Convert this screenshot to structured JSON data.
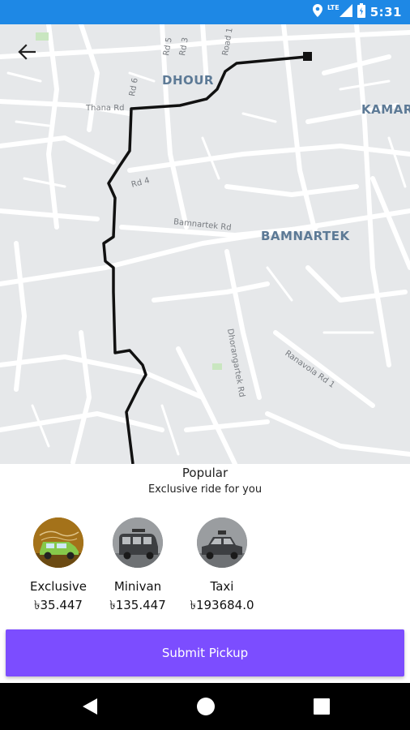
{
  "status_bar": {
    "time": "5:31",
    "network": "LTE",
    "icons": [
      "location-icon",
      "signal-icon",
      "battery-icon"
    ],
    "color": "#1e88e5"
  },
  "map": {
    "area_labels": [
      "DHOUR",
      "KAMAR",
      "BAMNARTEK"
    ],
    "road_labels": [
      "Rd 5",
      "Rd 3",
      "Road 1",
      "Rd 6",
      "Thana Rd",
      "Rd 4",
      "Bamnartek Rd",
      "Dhorangartek Rd",
      "Ranavola Rd 1"
    ],
    "back_icon": "arrow-left-icon"
  },
  "sheet": {
    "title": "Popular",
    "subtitle": "Exclusive ride for you",
    "options": [
      {
        "name": "Exclusive",
        "price": "৳35.447",
        "icon": "car-icon"
      },
      {
        "name": "Minivan",
        "price": "৳135.447",
        "icon": "minivan-icon"
      },
      {
        "name": "Taxi",
        "price": "৳193684.0",
        "icon": "taxi-icon"
      }
    ],
    "submit_label": "Submit Pickup",
    "accent": "#7c4dff"
  },
  "nav_bar": {
    "icons": [
      "back-triangle-icon",
      "home-circle-icon",
      "recents-square-icon"
    ]
  }
}
